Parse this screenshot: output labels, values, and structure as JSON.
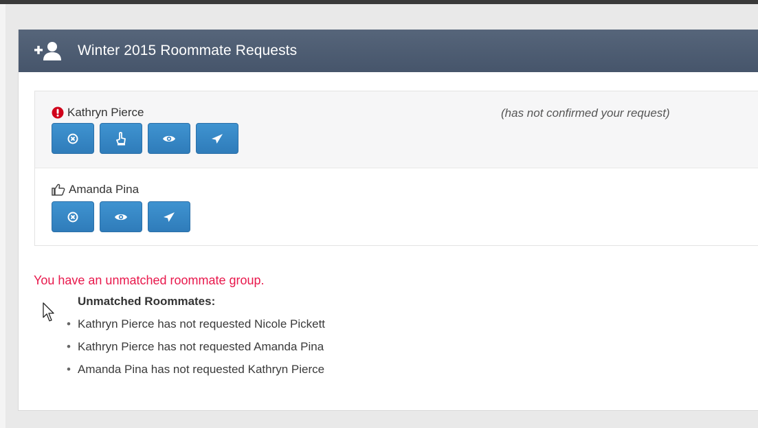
{
  "panel": {
    "title": "Winter 2015 Roommate Requests",
    "icon": "add-user-icon"
  },
  "requests": [
    {
      "name": "Kathryn Pierce",
      "status_icon": "exclamation-circle-icon",
      "note": "(has not confirmed your request)",
      "buttons": [
        "remove-icon",
        "hand-point-icon",
        "eye-icon",
        "send-icon"
      ]
    },
    {
      "name": "Amanda Pina",
      "status_icon": "thumbs-up-icon",
      "note": "",
      "buttons": [
        "remove-icon",
        "eye-icon",
        "send-icon"
      ]
    }
  ],
  "warning": "You have an unmatched roommate group.",
  "unmatched": {
    "title": "Unmatched Roommates:",
    "items": [
      "Kathryn Pierce has not requested Nicole Pickett",
      "Kathryn Pierce has not requested Amanda Pina",
      "Amanda Pina has not requested Kathryn Pierce"
    ]
  },
  "colors": {
    "header_bg": "#4f5e73",
    "button": "#3584c4",
    "warning": "#e8174b",
    "alert_red": "#d0021b"
  }
}
